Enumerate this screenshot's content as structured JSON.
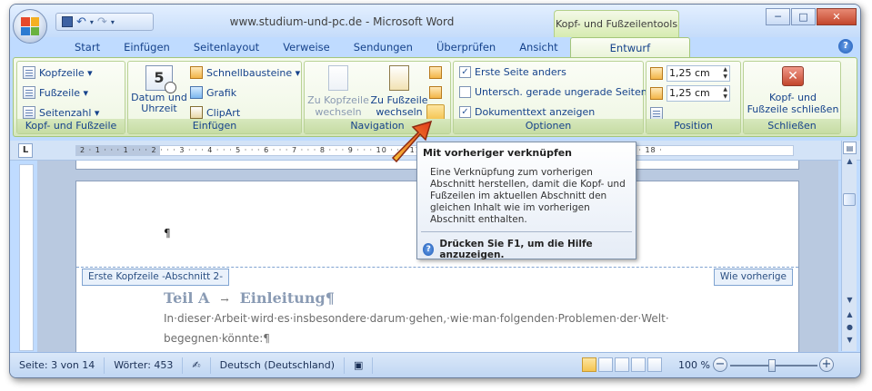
{
  "window": {
    "title": "www.studium-und-pc.de - Microsoft Word",
    "context_tool_label": "Kopf- und Fußzeilentools",
    "controls": {
      "minimize": "─",
      "maximize": "□",
      "close": "✕"
    }
  },
  "quick_access": {
    "save_icon": "save-icon",
    "undo_icon": "undo-icon",
    "redo_icon": "redo-icon",
    "more": "▾"
  },
  "tabs": [
    {
      "label": "Start"
    },
    {
      "label": "Einfügen"
    },
    {
      "label": "Seitenlayout"
    },
    {
      "label": "Verweise"
    },
    {
      "label": "Sendungen"
    },
    {
      "label": "Überprüfen"
    },
    {
      "label": "Ansicht"
    },
    {
      "label": "Entwurf"
    }
  ],
  "help_label": "?",
  "ribbon": {
    "group1": {
      "label": "Kopf- und Fußzeile",
      "kopfzeile": "Kopfzeile ▾",
      "fusszeile": "Fußzeile ▾",
      "seitenzahl": "Seitenzahl ▾"
    },
    "group2": {
      "label": "Einfügen",
      "datum": "Datum und",
      "uhrzeit": "Uhrzeit",
      "schnellbausteine": "Schnellbausteine ▾",
      "grafik": "Grafik",
      "clipart": "ClipArt",
      "calendar_day": "5"
    },
    "group3": {
      "label": "Navigation",
      "zu_kopfzeile_1": "Zu Kopfzeile",
      "zu_kopfzeile_2": "wechseln",
      "zu_fusszeile_1": "Zu Fußzeile",
      "zu_fusszeile_2": "wechseln"
    },
    "group4": {
      "label": "Optionen",
      "options": [
        {
          "label": "Erste Seite anders",
          "checked": true
        },
        {
          "label": "Untersch. gerade  ungerade Seiten",
          "checked": false
        },
        {
          "label": "Dokumenttext anzeigen",
          "checked": true
        }
      ]
    },
    "group5": {
      "label": "Position",
      "header_distance": "1,25 cm",
      "footer_distance": "1,25 cm"
    },
    "group6": {
      "label": "Schließen",
      "close_1": "Kopf- und",
      "close_2": "Fußzeile schließen"
    }
  },
  "ruler": {
    "selector": "L",
    "ticks": "2 · 1 · · · 1 · · · 2 · · · 3 · · · 4 · · · 5 · · · 6 · · · 7 · · · 8 · · · 9 · · · 10 · · · 11 · · · 12 · · · 13 · · · 14 · · · 15 · · · 16 · · · 17 · · · 18 ·"
  },
  "document": {
    "pilcrow": "¶",
    "header_tag": "Erste Kopfzeile -Abschnitt 2-",
    "prev_tag": "Wie vorherige",
    "heading_part1": "Teil A",
    "heading_arrow": "→",
    "heading_part2": "Einleitung¶",
    "line1": "In·dieser·Arbeit·wird·es·insbesondere·darum·gehen,·wie·man·folgenden·Problemen·der·Welt·",
    "line2": "begegnen·könnte:¶"
  },
  "tooltip": {
    "title": "Mit vorheriger verknüpfen",
    "body": "Eine Verknüpfung zum vorherigen Abschnitt herstellen, damit die Kopf- und Fußzeilen im aktuellen Abschnitt den gleichen Inhalt wie im vorherigen Abschnitt enthalten.",
    "help": "Drücken Sie F1, um die Hilfe anzuzeigen."
  },
  "status": {
    "page": "Seite: 3 von 14",
    "words": "Wörter: 453",
    "language": "Deutsch (Deutschland)",
    "zoom": "100 %",
    "zoom_minus": "−",
    "zoom_plus": "+"
  },
  "colors": {
    "accent": "#15428b",
    "context_tab": "#d6ebb0",
    "close_button": "#c3462c"
  }
}
